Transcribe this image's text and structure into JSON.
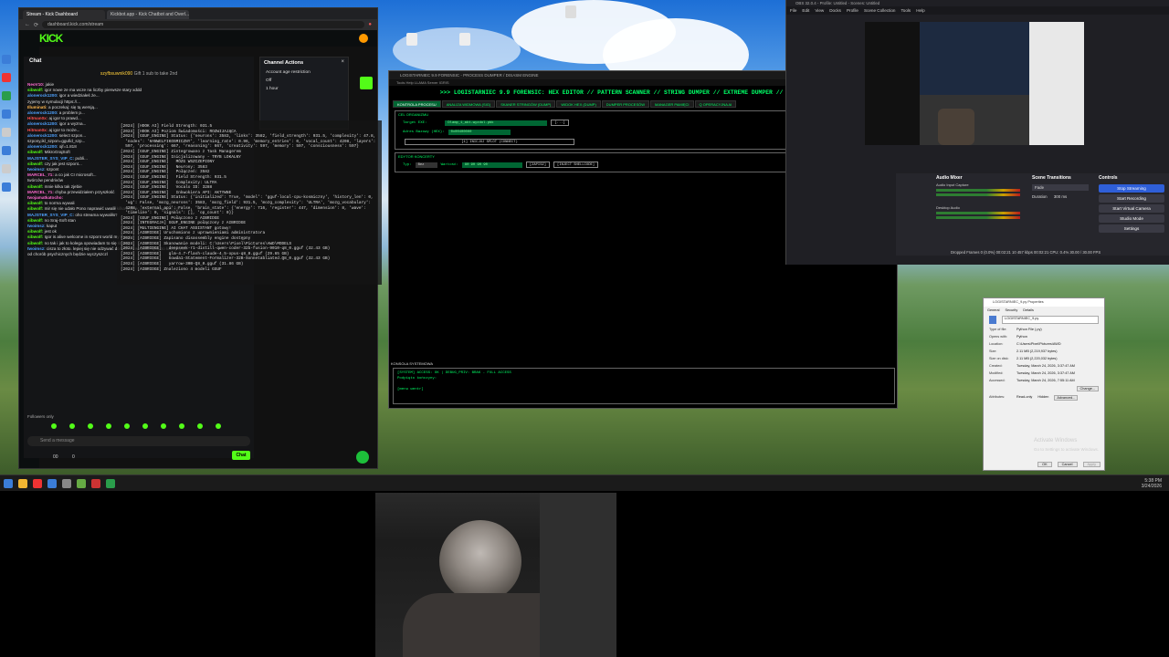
{
  "browser": {
    "tabs": [
      "Stream - Kick Dashboard",
      "Kickbot.app - Kick Chatbot and Overl..."
    ],
    "url": "dashboard.kick.com/stream",
    "logo": "KICK"
  },
  "chat": {
    "title": "Chat",
    "featured_user": "szyfbsuwnik090",
    "featured_note": "Gift 1 sub to take 2nd",
    "messages": [
      {
        "user": "NeoV10:",
        "text": " jakie",
        "color": "#ff6bd0"
      },
      {
        "user": "sibwolf:",
        "text": " igor nowe ze ma wcze na liczby pierwsze stary xddd",
        "color": "#53fc18"
      },
      {
        "user": "alonerock1200:",
        "text": " igor a wiedziałeś że...",
        "color": "#4fa3ff"
      },
      {
        "user": "",
        "text": "zyjemy w symulacji https://...",
        "color": "#ddd"
      },
      {
        "user": "Illuminati:",
        "text": " a poczekaj: się tą wersją...",
        "color": "#ffb84f"
      },
      {
        "user": "alonerock1200:",
        "text": " a problem p...",
        "color": "#4fa3ff"
      },
      {
        "user": "Hitman0x:",
        "text": " aj igor to prawd...",
        "color": "#ff4f4f"
      },
      {
        "user": "alonerock1200:",
        "text": " igor a wyzna...",
        "color": "#4fa3ff"
      },
      {
        "user": "Hitman0x:",
        "text": " aj igor to może...",
        "color": "#ff4f4f"
      },
      {
        "user": "alonerock1200:",
        "text": " select szpon...",
        "color": "#4fa3ff"
      },
      {
        "user": "",
        "text": "szpony,ikl_szpon=ggufid_szp...",
        "color": "#ddd"
      },
      {
        "user": "alonerock1200:",
        "text": " ojf=1.818",
        "color": "#4fa3ff"
      },
      {
        "user": "sibwolf:",
        "text": " MikroGrajSoft",
        "color": "#53fc18"
      },
      {
        "user": "MAJSTER_SYS_VIP_C:",
        "text": " publi...",
        "color": "#4fa3ff"
      },
      {
        "user": "sibwolf:",
        "text": " czy jak jest szpont...",
        "color": "#53fc18"
      },
      {
        "user": "twoimsz:",
        "text": " szpont",
        "color": "#4fa3ff"
      },
      {
        "user": "MARCEL_71:",
        "text": " a co jak CI microsoft...",
        "color": "#ff6bd0"
      },
      {
        "user": "",
        "text": "twórców pendrivów",
        "color": "#ddd"
      },
      {
        "user": "sibwolf:",
        "text": " mnie kilka tak zjebie",
        "color": "#53fc18"
      },
      {
        "user": "MARCEL_71:",
        "text": " chyba przewidziałem przyszłość",
        "color": "#ff6bd0"
      },
      {
        "user": "twojamatkatocho:",
        "text": "",
        "color": "#ff6bd0"
      },
      {
        "user": "sibwolf:",
        "text": " to norma wywali",
        "color": "#53fc18"
      },
      {
        "user": "sibwolf:",
        "text": " mir się nie udało Pono naprawić uwalił kilka a dysk wyczyścił Srajsoft jeb...",
        "color": "#53fc18"
      },
      {
        "user": "MAJSTER_SYS_VIP_C:",
        "text": " oho streama wywaliło?",
        "color": "#4fa3ff"
      },
      {
        "user": "sibwolf:",
        "text": " no Sraj-Soft stan",
        "color": "#53fc18"
      },
      {
        "user": "twoimsz:",
        "text": " kaput",
        "color": "#4fa3ff"
      },
      {
        "user": "sibwolf:",
        "text": " jest ok",
        "color": "#53fc18"
      },
      {
        "user": "sibwolf:",
        "text": " Igor is alive welcome in szpont world my friend",
        "color": "#53fc18"
      },
      {
        "user": "sibwolf:",
        "text": " no tak i jak to kolega opowiadam to się śmieją",
        "color": "#53fc18"
      },
      {
        "user": "twoimsz:",
        "text": " cisza to złoto. lepiej się nie odzywać do tych co w szafie śpią bo każdy tylko",
        "color": "#4fa3ff"
      },
      {
        "user": "",
        "text": "od chorób psychicznych będzie wyczyszczl",
        "color": "#ddd"
      }
    ],
    "followers_only": "Followers only",
    "send_placeholder": "Send a message",
    "counter_a": "00",
    "counter_b": "0",
    "chat_button": "Chat"
  },
  "channel_actions": {
    "title": "Channel Actions",
    "setting": "Account age restriction",
    "options": [
      "Off",
      "1 hour"
    ]
  },
  "terminal_lines": [
    "[2024] [HOOK AI] Field Strength: 031.5",
    "[2024] [HOOK AI] Poziom Świadomości: ROZWIJAJĄCA",
    "[2024] [GGUF_ENGINE] Status: {'neurons': 3583, 'links': 3582, 'field_strength': 931.5, 'complexity': 47.8,",
    "  'nodes': 'HANWELFIKOSMICZNY', 'learning_rate': 0.96, 'memory_entries': 0, 'vocal_count': 4208, 'layers':",
    "  597, 'processing': 667, 'reasoning': 667, 'creativity': 597, 'memory': 597, 'consciousness': 597}",
    "[2024] [GGUF_ENGINE] Zintegrowano z Task Managerem",
    "[2024] [GGUF_ENGINE] Inicjalizowany - TRYB LOKALNY",
    "[2024] [GGUF_ENGINE]   MÓZG WSZCZEPIONY",
    "[2024] [GGUF_ENGINE]   Neurony: 3583",
    "[2024] [GGUF_ENGINE]   Połączeń: 3582",
    "[2024] [GGUF_ENGINE]   Field Strength: 931.5",
    "[2024] [GGUF_ENGINE]   Complexity: ULTRA",
    "[2024] [GGUF_ENGINE]   Vocalo ID: 3288",
    "[2024] [GGUF_ENGINE]   Inkwokiera API: AKTYWNE",
    "[2024] [GGUF_ENGINE] Status: {'initialized': True, 'model': 'gguf-local-cpu-kosmiczny', 'history_len': 0,",
    "  'ug': False, 'mozg_neurons': 3583, 'mozg_field': 931.5, 'mozg_complexity': 'ULTRA', 'mozg_vocabulary':",
    "  4208, 'external_api': False, 'brain_state': {'energy': 716, 'register': 447, 'dimension': 8, 'wave':",
    "  'timeline': 0, 'signals': [], 'op_count': 0}}",
    "[2024] [GGUF_ENGINE] Połączono z AIBRIDGE",
    "[2024] [INTEGRACJA] GGUF_ENGINE połączony z AIBRIDGE",
    "[2024] [MULTIENGINE] AI CHAT ASSISTANT gotowy!",
    "[2024] [AIBRIDGE] Uruchomiono z uprawnieniami administratora",
    "[2024] [AIBRIDGE] Zapisano disassembly engine dostępny",
    "[2024] [AIBRIDGE] Skanowanie modeli: C:\\Users\\Pixel\\Pictures\\AWD\\MODELS",
    "[2024] [AIBRIDGE]   deepseek-r1-distill-qwen-coder-32b-fusion-9010-q8_0.gguf (32.43 GB)",
    "[2024] [AIBRIDGE]   glm-4.7-flash-claude-4.5-opus-q8_0.gguf (29.65 GB)",
    "[2024] [AIBRIDGE]   Gowda1-Statement-Formalizer-32B-Sonnetabliated.Q8_0.gguf (32.43 GB)",
    "[2024] [AIBRIDGE]   yarrow-30B-Q8_0.gguf (31.86 GB)",
    "[2024] [AIBRIDGE] Znaleziono 4 modeli GGUF"
  ],
  "forensic": {
    "title": "LOGISTARNIEC 9.9 FORENSIC - PROCESS DUMPER / DISASM ENGINE",
    "menu": "Tools   Help   LLAMA Server   IGRIS",
    "banner": ">>> LOGISTARNIEC 9.9 FORENSIC: HEX EDITOR // PATTERN SCANNER // STRING DUMPER // EXTREME DUMPER // DISASM ENGINE <<<",
    "tabs": [
      "KONTROLA PROCESU",
      "ANALIZA WIDMOWA (SIG)",
      "SKANER STRINGÓW (DUMP)",
      "WIDOK HEX (DUMP)",
      "DUMPER PROCESÓW",
      "MANAGER PAMIĘCI",
      "Q OPERACYJNA AI"
    ],
    "target_section": "CEL ORGANIZMU",
    "target_label": "Target EXE:",
    "target_value": "Dlamp_1_akt-wyzdol.pbk",
    "browse": "[...]",
    "addr_label": "Adres Bazowy (HEX):",
    "addr_value": "0x00400000",
    "attach_button": "[1] INICJUJ SPLOT (CONNECT)",
    "editor_section": "EDYTOR KONCERTY",
    "type_label": "Typ:",
    "type_value": "Bez",
    "value_label": "Wartość:",
    "value_value": "90 90 90 90",
    "write_button": "[ZAPISZ]",
    "inject_button": "[INJECT SHELLCODE]",
    "console_title": "KONSOLA SYSTEMOWA",
    "console_lines": [
      "[SYSTEM] ACCESS: OK | DEBUG_PRIV: BRAK - FULL ACCESS",
      "Podpięto kończyny:",
      "",
      "[menu wentr]"
    ]
  },
  "obs": {
    "title": "OBS 32.0.4 - Profile: Untitled - Scenes: Untitled",
    "menu": [
      "File",
      "Edit",
      "View",
      "Docks",
      "Profile",
      "Scene Collection",
      "Tools",
      "Help"
    ],
    "mixer_title": "Audio Mixer",
    "mixer_channels": [
      "Audio Input Capture",
      "Desktop Audio"
    ],
    "transitions_title": "Scene Transitions",
    "transition": "Fade",
    "duration_label": "Duration",
    "duration": "300 ms",
    "controls_title": "Controls",
    "controls": [
      "Stop Streaming",
      "Start Recording",
      "Start Virtual Camera",
      "Studio Mode",
      "Settings"
    ],
    "status": "Dropped Frames 0 (0.0%)    00:02:21    10 457 kbps    00:02:21    CPU: 0.4%    30.00 / 30.00 FPS"
  },
  "props": {
    "title": "LOGISTARNIEC_9.py Properties",
    "tabs": [
      "General",
      "Security",
      "Details"
    ],
    "filename": "LOGISTARNIEC_9.py",
    "rows": [
      [
        "Type of file:",
        "Python File (.py)"
      ],
      [
        "Opens with:",
        "Python"
      ],
      [
        "Location:",
        "C:\\Users\\Pixel\\Pictures\\AWD"
      ],
      [
        "Size:",
        "2.11 MB (2,219,937 bytes)"
      ],
      [
        "Size on disk:",
        "2.11 MB (2,220,032 bytes)"
      ],
      [
        "Created:",
        "Tuesday, March 24, 2026, 3:37:47 AM"
      ],
      [
        "Modified:",
        "Tuesday, March 24, 2026, 3:37:47 AM"
      ],
      [
        "Accessed:",
        "Tuesday, March 24, 2026, 7:55:11 AM"
      ]
    ],
    "change_button": "Change...",
    "attributes_label": "Attributes:",
    "readonly": "Read-only",
    "hidden": "Hidden",
    "advanced": "Advanced...",
    "ok": "OK",
    "cancel": "Cancel",
    "apply": "Apply"
  },
  "activate": {
    "line1": "Activate Windows",
    "line2": "Go to Settings to activate Windows."
  },
  "taskbar": {
    "time": "5:38 PM",
    "date": "3/24/2026"
  },
  "colors": {
    "kick_green": "#53fc18",
    "terminal_green": "#00ff66"
  }
}
